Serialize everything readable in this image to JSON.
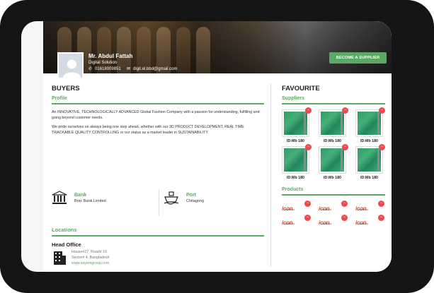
{
  "profile": {
    "name": "Mr. Abdul Fattah",
    "company": "Digital Solution",
    "phone": "01618009851",
    "email": "digit.el.bbd@gmail.com",
    "become_supplier": "BECOME A SUPPLIER"
  },
  "buyers": {
    "title": "BUYERS",
    "profile_heading": "Profile",
    "para1": "An INNOVATIVE, TECHNOLOGICALLY ADVANCED Global Fashion Company with a passion for understanding, fulfilling and going beyond customer needs.",
    "para2": "We pride ourselves on always being one step ahead, whether with our 3D PRODUCT DEVELOPMENT, REAL TIME TRACKABLE QUALITY CONTROLLING or our status as a market leader in SUSTAINABILITY.",
    "bank_label": "Bank",
    "bank_value": "Brac Bank Limited",
    "port_label": "Port",
    "port_value": "Chitagong",
    "locations_heading": "Locations",
    "office_title": "Head Office",
    "address1": "House#27, Road# 16",
    "address2": "Sector# 4, Bangladesh",
    "website": "www.sayemgroup.com"
  },
  "favourite": {
    "title": "FAVOURITE",
    "suppliers_heading": "Suppliers",
    "suppliers": [
      "ID:Mb 180",
      "ID:Mb 180",
      "ID:Mb 180",
      "ID:Mb 180",
      "ID:Mb 180",
      "ID:Mb 180"
    ],
    "products_heading": "Products",
    "product_logo_text": "icon",
    "product_logo_sub": "TEXTILES",
    "products": 6
  },
  "colors": {
    "accent": "#5aaa64",
    "badge": "#e84c50"
  }
}
